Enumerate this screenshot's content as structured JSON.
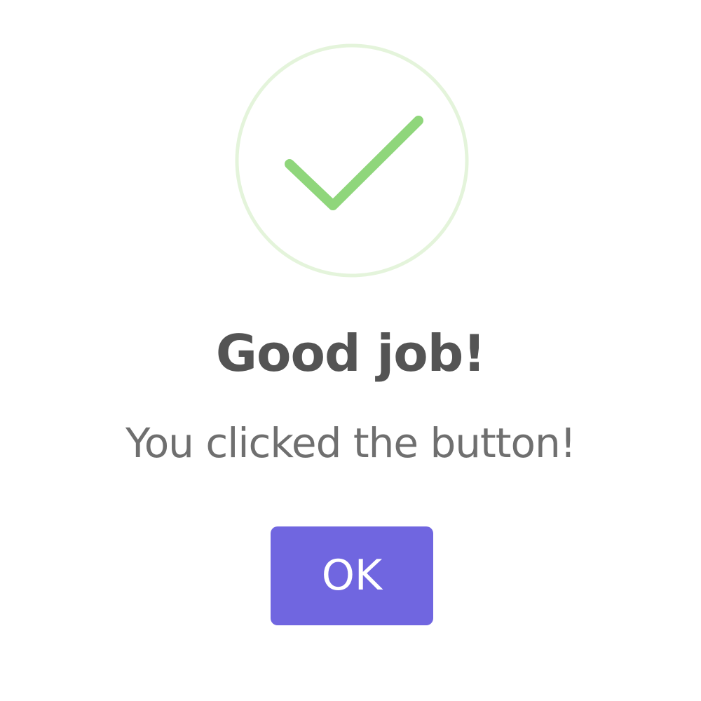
{
  "dialog": {
    "icon": "success-check-icon",
    "title": "Good job!",
    "text": "You clicked the button!",
    "confirm_label": "OK"
  },
  "colors": {
    "success_ring": "#e4f4db",
    "success_check": "#8fd67b",
    "title": "#545454",
    "text": "#6f6f6f",
    "confirm_button": "#7066e0",
    "confirm_text": "#ffffff"
  }
}
